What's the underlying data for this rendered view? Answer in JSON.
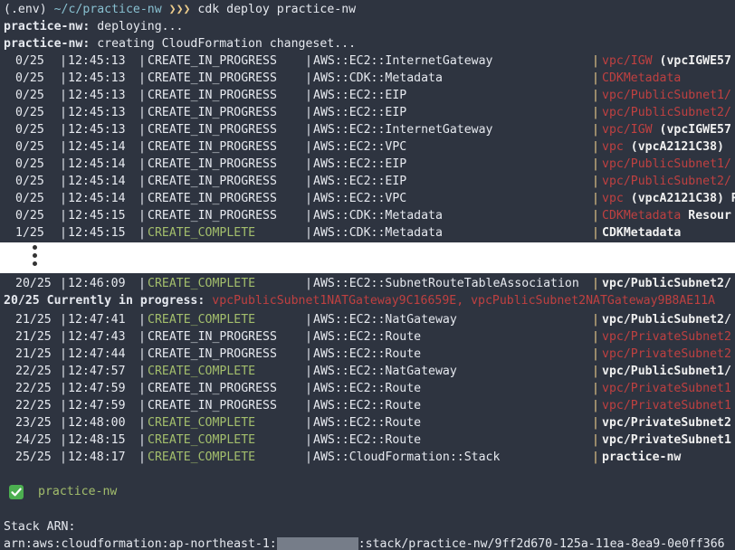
{
  "prompt": {
    "env": "(.env)",
    "path": "~/c/practice-nw",
    "arrows": "❯❯❯",
    "command": "cdk deploy practice-nw"
  },
  "header_lines": [
    {
      "label": "practice-nw:",
      "text": " deploying..."
    },
    {
      "label": "practice-nw:",
      "text": " creating CloudFormation changeset..."
    }
  ],
  "events_top": [
    {
      "progress": "0/25",
      "time": "12:45:13",
      "status": "CREATE_IN_PROGRESS",
      "type": "AWS::EC2::InternetGateway",
      "resource_red": "vpc/IGW",
      "resource_white": " (vpcIGWE57"
    },
    {
      "progress": "0/25",
      "time": "12:45:13",
      "status": "CREATE_IN_PROGRESS",
      "type": "AWS::CDK::Metadata",
      "resource_red": "CDKMetadata",
      "resource_white": ""
    },
    {
      "progress": "0/25",
      "time": "12:45:13",
      "status": "CREATE_IN_PROGRESS",
      "type": "AWS::EC2::EIP",
      "resource_red": "vpc/PublicSubnet1/",
      "resource_white": ""
    },
    {
      "progress": "0/25",
      "time": "12:45:13",
      "status": "CREATE_IN_PROGRESS",
      "type": "AWS::EC2::EIP",
      "resource_red": "vpc/PublicSubnet2/",
      "resource_white": ""
    },
    {
      "progress": "0/25",
      "time": "12:45:13",
      "status": "CREATE_IN_PROGRESS",
      "type": "AWS::EC2::InternetGateway",
      "resource_red": "vpc/IGW",
      "resource_white": " (vpcIGWE57"
    },
    {
      "progress": "0/25",
      "time": "12:45:14",
      "status": "CREATE_IN_PROGRESS",
      "type": "AWS::EC2::VPC",
      "resource_red": "vpc",
      "resource_white": " (vpcA2121C38)"
    },
    {
      "progress": "0/25",
      "time": "12:45:14",
      "status": "CREATE_IN_PROGRESS",
      "type": "AWS::EC2::EIP",
      "resource_red": "vpc/PublicSubnet1/",
      "resource_white": ""
    },
    {
      "progress": "0/25",
      "time": "12:45:14",
      "status": "CREATE_IN_PROGRESS",
      "type": "AWS::EC2::EIP",
      "resource_red": "vpc/PublicSubnet2/",
      "resource_white": ""
    },
    {
      "progress": "0/25",
      "time": "12:45:14",
      "status": "CREATE_IN_PROGRESS",
      "type": "AWS::EC2::VPC",
      "resource_red": "vpc",
      "resource_white": " (vpcA2121C38) R"
    },
    {
      "progress": "0/25",
      "time": "12:45:15",
      "status": "CREATE_IN_PROGRESS",
      "type": "AWS::CDK::Metadata",
      "resource_red": "CDKMetadata",
      "resource_white": " Resour"
    },
    {
      "progress": "1/25",
      "time": "12:45:15",
      "status": "CREATE_COMPLETE",
      "type": "AWS::CDK::Metadata",
      "resource_red": "",
      "resource_white": "CDKMetadata"
    }
  ],
  "events_bottom_first": {
    "progress": "20/25",
    "time": "12:46:09",
    "status": "CREATE_COMPLETE",
    "type": "AWS::EC2::SubnetRouteTableAssociation",
    "resource_red": "",
    "resource_white": "vpc/PublicSubnet2/"
  },
  "in_progress_line": {
    "label": "20/25 Currently in progress:",
    "items": " vpcPublicSubnet1NATGateway9C16659E, vpcPublicSubnet2NATGateway9B8AE11A"
  },
  "events_bottom": [
    {
      "progress": "21/25",
      "time": "12:47:41",
      "status": "CREATE_COMPLETE",
      "type": "AWS::EC2::NatGateway",
      "resource_red": "",
      "resource_white": "vpc/PublicSubnet2/"
    },
    {
      "progress": "21/25",
      "time": "12:47:43",
      "status": "CREATE_IN_PROGRESS",
      "type": "AWS::EC2::Route",
      "resource_red": "vpc/PrivateSubnet2",
      "resource_white": ""
    },
    {
      "progress": "21/25",
      "time": "12:47:44",
      "status": "CREATE_IN_PROGRESS",
      "type": "AWS::EC2::Route",
      "resource_red": "vpc/PrivateSubnet2",
      "resource_white": ""
    },
    {
      "progress": "22/25",
      "time": "12:47:57",
      "status": "CREATE_COMPLETE",
      "type": "AWS::EC2::NatGateway",
      "resource_red": "",
      "resource_white": "vpc/PublicSubnet1/"
    },
    {
      "progress": "22/25",
      "time": "12:47:59",
      "status": "CREATE_IN_PROGRESS",
      "type": "AWS::EC2::Route",
      "resource_red": "vpc/PrivateSubnet1",
      "resource_white": ""
    },
    {
      "progress": "22/25",
      "time": "12:47:59",
      "status": "CREATE_IN_PROGRESS",
      "type": "AWS::EC2::Route",
      "resource_red": "vpc/PrivateSubnet1",
      "resource_white": ""
    },
    {
      "progress": "23/25",
      "time": "12:48:00",
      "status": "CREATE_COMPLETE",
      "type": "AWS::EC2::Route",
      "resource_red": "",
      "resource_white": "vpc/PrivateSubnet2"
    },
    {
      "progress": "24/25",
      "time": "12:48:15",
      "status": "CREATE_COMPLETE",
      "type": "AWS::EC2::Route",
      "resource_red": "",
      "resource_white": "vpc/PrivateSubnet1"
    },
    {
      "progress": "25/25",
      "time": "12:48:17",
      "status": "CREATE_COMPLETE",
      "type": "AWS::CloudFormation::Stack",
      "resource_red": "",
      "resource_white": "practice-nw"
    }
  ],
  "success": {
    "stack_name": "practice-nw"
  },
  "stack_arn": {
    "label": "Stack ARN:",
    "prefix": "arn:aws:cloudformation:ap-northeast-1:",
    "suffix": ":stack/practice-nw/9ff2d670-125a-11ea-8ea9-0e0ff366"
  },
  "colors": {
    "background": "#2e3440",
    "complete": "#a3be6c",
    "pending_resource": "#bf4040",
    "path": "#88c0d0"
  }
}
